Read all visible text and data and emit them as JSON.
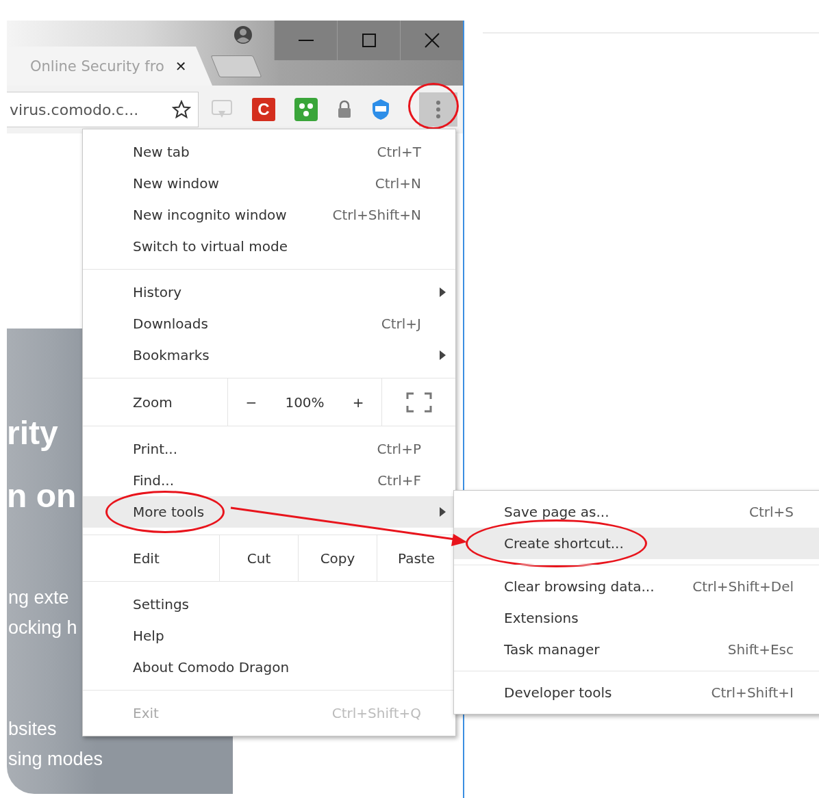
{
  "tab": {
    "title": "Online Security fro",
    "close": "✕"
  },
  "address_bar": {
    "value": "virus.comodo.c..."
  },
  "toolbar": {
    "extension_letter": "C"
  },
  "menu_button": {
    "circled": true
  },
  "page_fragments": [
    {
      "kind": "heading",
      "text": "rity"
    },
    {
      "kind": "heading",
      "text": "n on"
    },
    {
      "kind": "body",
      "text": "ng exte"
    },
    {
      "kind": "body",
      "text": "ocking h"
    },
    {
      "kind": "gap"
    },
    {
      "kind": "body",
      "text": "bsites"
    },
    {
      "kind": "body",
      "text": "sing modes"
    }
  ],
  "menu": {
    "sections": [
      {
        "items": [
          {
            "kind": "command",
            "label": "New tab",
            "shortcut": "Ctrl+T",
            "has_submenu": false,
            "selected": false,
            "disabled": false,
            "circled": false
          },
          {
            "kind": "command",
            "label": "New window",
            "shortcut": "Ctrl+N",
            "has_submenu": false,
            "selected": false,
            "disabled": false,
            "circled": false
          },
          {
            "kind": "command",
            "label": "New incognito window",
            "shortcut": "Ctrl+Shift+N",
            "has_submenu": false,
            "selected": false,
            "disabled": false,
            "circled": false
          },
          {
            "kind": "command",
            "label": "Switch to virtual mode",
            "has_submenu": false,
            "selected": false,
            "disabled": false,
            "circled": false
          }
        ]
      },
      {
        "items": [
          {
            "kind": "command",
            "label": "History",
            "has_submenu": true,
            "selected": false,
            "disabled": false,
            "circled": false
          },
          {
            "kind": "command",
            "label": "Downloads",
            "shortcut": "Ctrl+J",
            "has_submenu": false,
            "selected": false,
            "disabled": false,
            "circled": false
          },
          {
            "kind": "command",
            "label": "Bookmarks",
            "has_submenu": true,
            "selected": false,
            "disabled": false,
            "circled": false
          }
        ]
      },
      {
        "items": [
          {
            "kind": "zoom",
            "label": "Zoom",
            "minus": "−",
            "value": "100%",
            "plus": "+"
          }
        ]
      },
      {
        "items": [
          {
            "kind": "command",
            "label": "Print...",
            "shortcut": "Ctrl+P",
            "has_submenu": false,
            "selected": false,
            "disabled": false,
            "circled": false
          },
          {
            "kind": "command",
            "label": "Find...",
            "shortcut": "Ctrl+F",
            "has_submenu": false,
            "selected": false,
            "disabled": false,
            "circled": false
          },
          {
            "kind": "command",
            "label": "More tools",
            "has_submenu": true,
            "selected": true,
            "disabled": false,
            "circled": true
          }
        ]
      },
      {
        "items": [
          {
            "kind": "edit",
            "label": "Edit",
            "actions": [
              "Cut",
              "Copy",
              "Paste"
            ]
          }
        ]
      },
      {
        "items": [
          {
            "kind": "command",
            "label": "Settings",
            "has_submenu": false,
            "selected": false,
            "disabled": false,
            "circled": false
          },
          {
            "kind": "command",
            "label": "Help",
            "has_submenu": false,
            "selected": false,
            "disabled": false,
            "circled": false
          },
          {
            "kind": "command",
            "label": "About Comodo Dragon",
            "has_submenu": false,
            "selected": false,
            "disabled": false,
            "circled": false
          }
        ]
      },
      {
        "items": [
          {
            "kind": "command",
            "label": "Exit",
            "shortcut": "Ctrl+Shift+Q",
            "has_submenu": false,
            "selected": false,
            "disabled": true,
            "circled": false
          }
        ]
      }
    ]
  },
  "submenu": {
    "sections": [
      {
        "items": [
          {
            "kind": "command",
            "label": "Save page as...",
            "shortcut": "Ctrl+S",
            "has_submenu": false,
            "selected": false,
            "disabled": false,
            "circled": false
          },
          {
            "kind": "command",
            "label": "Create shortcut...",
            "has_submenu": false,
            "selected": true,
            "disabled": false,
            "circled": true
          }
        ]
      },
      {
        "items": [
          {
            "kind": "command",
            "label": "Clear browsing data...",
            "shortcut": "Ctrl+Shift+Del",
            "has_submenu": false,
            "selected": false,
            "disabled": false,
            "circled": false
          },
          {
            "kind": "command",
            "label": "Extensions",
            "has_submenu": false,
            "selected": false,
            "disabled": false,
            "circled": false
          },
          {
            "kind": "command",
            "label": "Task manager",
            "shortcut": "Shift+Esc",
            "has_submenu": false,
            "selected": false,
            "disabled": false,
            "circled": false
          }
        ]
      },
      {
        "items": [
          {
            "kind": "command",
            "label": "Developer tools",
            "shortcut": "Ctrl+Shift+I",
            "has_submenu": false,
            "selected": false,
            "disabled": false,
            "circled": false
          }
        ]
      }
    ]
  }
}
